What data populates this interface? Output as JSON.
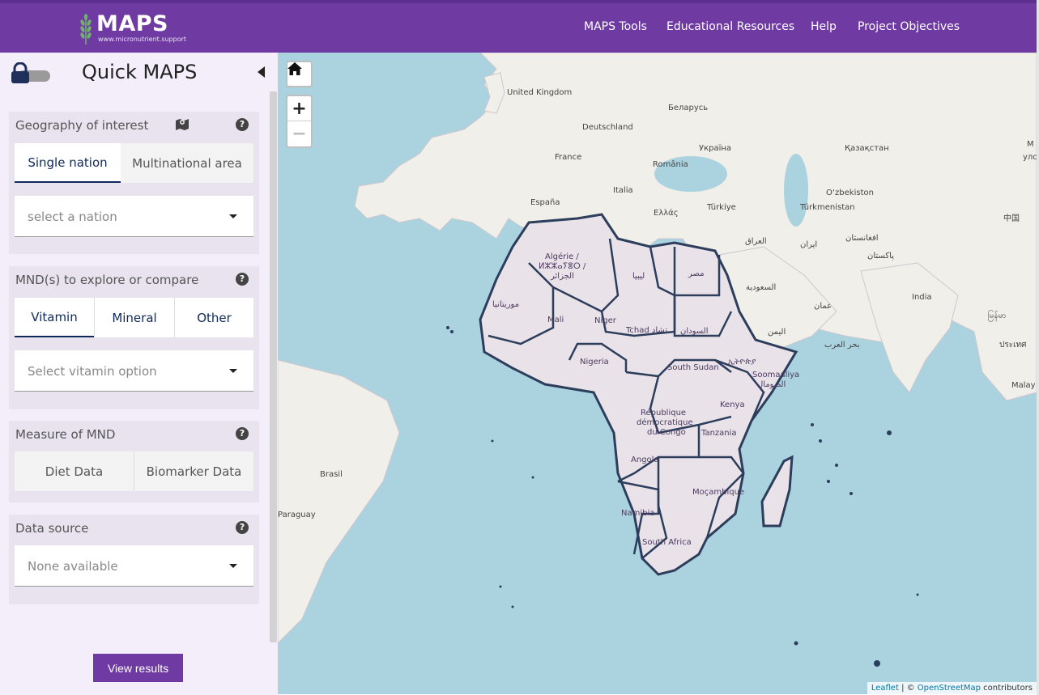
{
  "header": {
    "logo_title": "MAPS",
    "logo_subtitle": "www.micronutrient.support",
    "nav": [
      "MAPS Tools",
      "Educational Resources",
      "Help",
      "Project Objectives"
    ]
  },
  "sidebar": {
    "title": "Quick MAPS",
    "geography": {
      "heading": "Geography of interest",
      "tabs": [
        "Single nation",
        "Multinational area"
      ],
      "select_placeholder": "select a nation"
    },
    "mnd": {
      "heading": "MND(s) to explore or compare",
      "tabs": [
        "Vitamin",
        "Mineral",
        "Other"
      ],
      "select_placeholder": "Select vitamin option"
    },
    "measure": {
      "heading": "Measure of MND",
      "tabs": [
        "Diet Data",
        "Biomarker Data"
      ]
    },
    "source": {
      "heading": "Data source",
      "select_placeholder": "None available"
    },
    "help_glyph": "?",
    "view_results": "View results"
  },
  "map": {
    "zoom_in": "+",
    "zoom_out": "−",
    "labels": {
      "uk": "United Kingdom",
      "belarus": "Беларусь",
      "deutschland": "Deutschland",
      "france": "France",
      "ukraine": "Україна",
      "kazakhstan": "Қазақстан",
      "romania": "România",
      "italia": "Italia",
      "espana": "España",
      "ellada": "Ελλάς",
      "turkiye": "Türkiye",
      "uzbekistan": "O‘zbekiston",
      "turkmenistan": "Türkmenistan",
      "china": "中国",
      "iraq": "العراق",
      "iran": "ایران",
      "afghanistan": "افغانستان",
      "pakistan": "پاکستان",
      "saudi": "السعودية",
      "oman": "عمان",
      "yemen": "اليمن",
      "india": "India",
      "myanmar": "မြန်မာ",
      "arabian_sea": "بحر العرب",
      "thailand": "ประเทศ",
      "malay": "Malay",
      "mongolia_1": "М",
      "mongolia_2": "улс",
      "algeria_1": "Algérie /",
      "algeria_2": "ⵍⵣⵣⴰⵢⴻⵔ /",
      "algeria_3": "الجزائر",
      "libya": "ليبيا",
      "egypt": "مصر",
      "mauritania": "موريتانيا",
      "mali": "Mali",
      "niger": "Niger",
      "chad": "Tchad تشاد",
      "sudan": "السودان",
      "ethiopia": "ኢትዮጵያ",
      "nigeria": "Nigeria",
      "south_sudan": "South Sudan",
      "somalia_1": "Soomaaliya",
      "somalia_2": "الصومال",
      "kenya": "Kenya",
      "drc_1": "République",
      "drc_2": "démocratique",
      "drc_3": "du Congo",
      "tanzania": "Tanzania",
      "angola": "Angola",
      "mozambique": "Moçambique",
      "namibia": "Namibia",
      "south_africa": "South Africa",
      "brasil": "Brasil",
      "paraguay": "Paraguay"
    },
    "attribution": {
      "leaflet": "Leaflet",
      "sep": " | © ",
      "osm": "OpenStreetMap",
      "contributors": " contributors"
    }
  }
}
